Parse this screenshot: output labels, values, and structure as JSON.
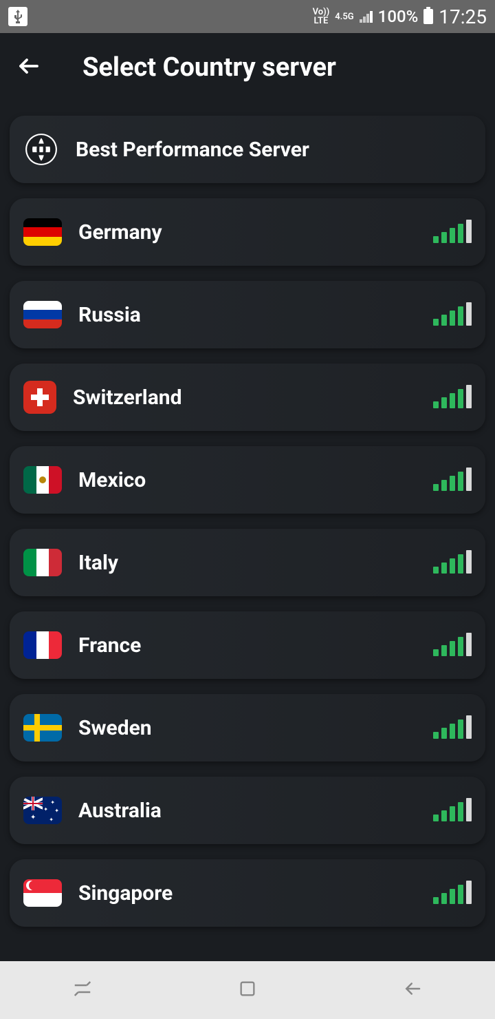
{
  "status": {
    "lte": "Vo))\nLTE",
    "net": "4.5G",
    "battery": "100%",
    "time": "17:25"
  },
  "header": {
    "title": "Select Country server"
  },
  "best": {
    "label": "Best Performance Server"
  },
  "servers": [
    {
      "name": "Germany",
      "flag": "germany"
    },
    {
      "name": "Russia",
      "flag": "russia"
    },
    {
      "name": "Switzerland",
      "flag": "switzerland"
    },
    {
      "name": "Mexico",
      "flag": "mexico"
    },
    {
      "name": "Italy",
      "flag": "italy"
    },
    {
      "name": "France",
      "flag": "france"
    },
    {
      "name": "Sweden",
      "flag": "sweden"
    },
    {
      "name": "Australia",
      "flag": "australia"
    },
    {
      "name": "Singapore",
      "flag": "singapore"
    }
  ]
}
